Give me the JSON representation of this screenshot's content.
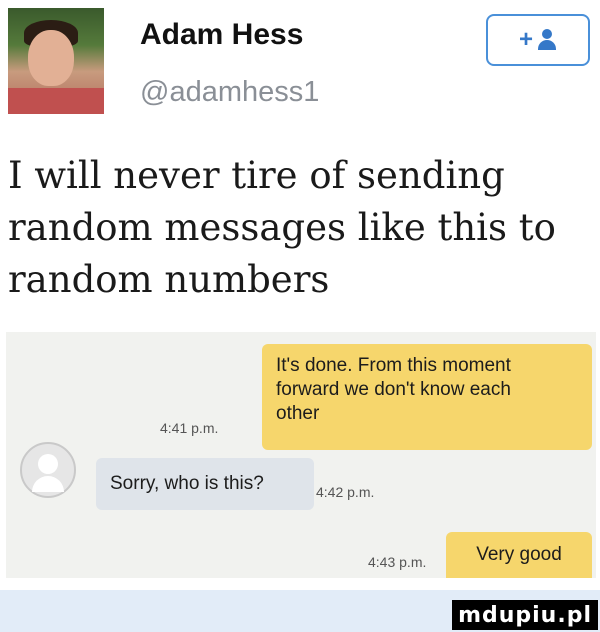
{
  "profile": {
    "display_name": "Adam Hess",
    "handle": "@adamhess1",
    "follow_icon": "add-person-icon",
    "follow_label": "+"
  },
  "tweet": {
    "lines": [
      "I will never tire of sending",
      "random messages like this to",
      "random numbers"
    ]
  },
  "conversation": {
    "message1": {
      "lines": [
        "It's done. From this moment",
        "forward we don't know each",
        "other"
      ],
      "time": "4:41 p.m."
    },
    "message2": {
      "text": "Sorry, who is this?",
      "time": "4:42 p.m."
    },
    "message3": {
      "text": "Very good",
      "time": "4:43 p.m."
    }
  },
  "watermark": "mdupiu.pl",
  "colors": {
    "incoming_bubble": "#f6d66c",
    "outgoing_bubble": "#dfe4ea",
    "follow_accent": "#3578c8",
    "handle_gray": "#8a8f96"
  }
}
